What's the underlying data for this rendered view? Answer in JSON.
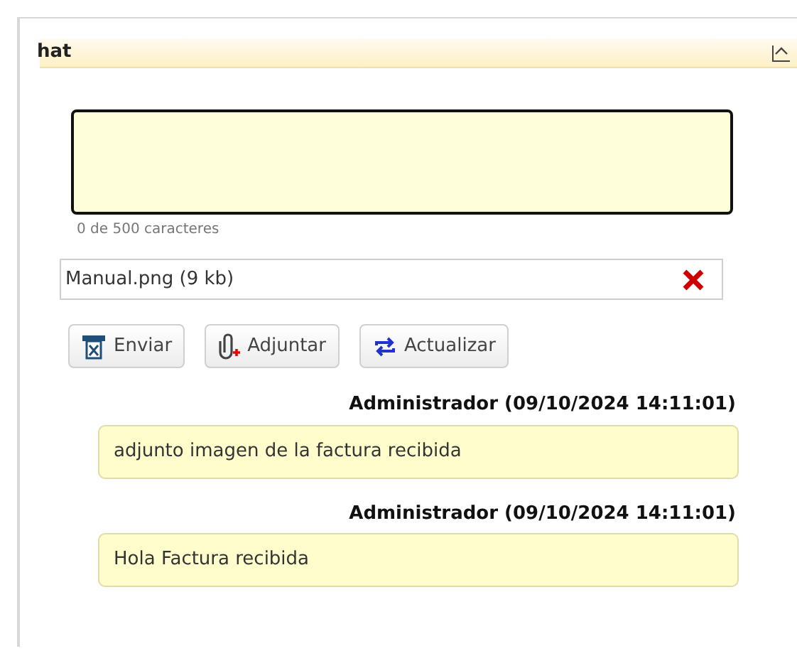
{
  "panel": {
    "title": "hat",
    "expanded": true
  },
  "char_counter": "0 de 500 caracteres",
  "attachment": {
    "file": "Manual.png (9 kb)"
  },
  "buttons": [
    {
      "label": "Enviar",
      "kind": "send"
    },
    {
      "label": "Adjuntar",
      "kind": "attach"
    },
    {
      "label": "Actualizar",
      "kind": "refresh"
    }
  ],
  "messages": [
    {
      "author": "Administrador",
      "time": "(09/10/2024 14:11:01)",
      "text": "adjunto imagen de la factura recibida"
    },
    {
      "author": "Administrador",
      "time": "(09/10/2024 14:11:01)",
      "text": "Hola Factura recibida"
    }
  ]
}
